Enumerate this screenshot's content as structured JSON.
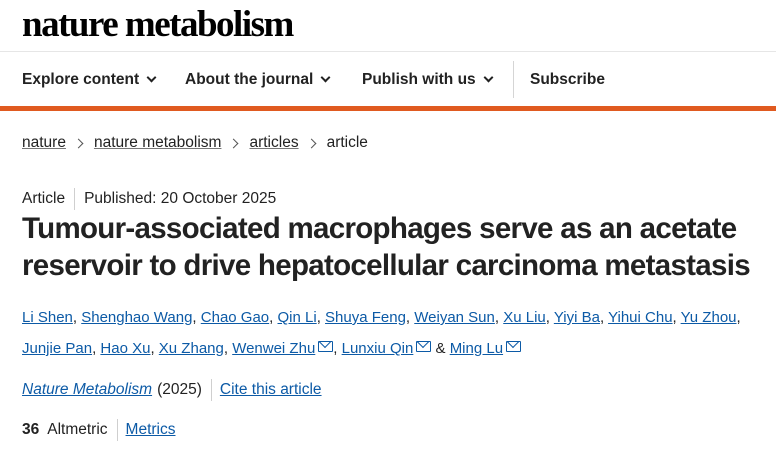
{
  "site": {
    "logo_text": "nature metabolism"
  },
  "nav": {
    "items": [
      {
        "label": "Explore content",
        "dropdown": true
      },
      {
        "label": "About the journal",
        "dropdown": true
      },
      {
        "label": "Publish with us",
        "dropdown": true
      }
    ],
    "subscribe_label": "Subscribe"
  },
  "colors": {
    "accent": "#e05a20",
    "link": "#0c5aa6"
  },
  "breadcrumb": [
    "nature",
    "nature metabolism",
    "articles",
    "article"
  ],
  "article": {
    "type": "Article",
    "published": "Published: 20 October 2025",
    "title": "Tumour-associated macrophages serve as an acetate reservoir to drive hepatocellular carcinoma metastasis",
    "authors": [
      {
        "name": "Li Shen",
        "email": false,
        "sep": ", "
      },
      {
        "name": "Shenghao Wang",
        "email": false,
        "sep": ", "
      },
      {
        "name": "Chao Gao",
        "email": false,
        "sep": ", "
      },
      {
        "name": "Qin Li",
        "email": false,
        "sep": ", "
      },
      {
        "name": "Shuya Feng",
        "email": false,
        "sep": ", "
      },
      {
        "name": "Weiyan Sun",
        "email": false,
        "sep": ", "
      },
      {
        "name": "Xu Liu",
        "email": false,
        "sep": ", "
      },
      {
        "name": "Yiyi Ba",
        "email": false,
        "sep": ", "
      },
      {
        "name": "Yihui Chu",
        "email": false,
        "sep": ", "
      },
      {
        "name": "Yu Zhou",
        "email": false,
        "sep": ", "
      },
      {
        "name": "Junjie Pan",
        "email": false,
        "sep": ", "
      },
      {
        "name": "Hao Xu",
        "email": false,
        "sep": ", "
      },
      {
        "name": "Xu Zhang",
        "email": false,
        "sep": ", "
      },
      {
        "name": "Wenwei Zhu",
        "email": true,
        "sep": ", "
      },
      {
        "name": "Lunxiu Qin",
        "email": true,
        "sep": " & "
      },
      {
        "name": "Ming Lu",
        "email": true,
        "sep": ""
      }
    ],
    "journal": "Nature Metabolism",
    "year": "(2025)",
    "cite_label": "Cite this article",
    "altmetric_score": "36",
    "altmetric_label": "Altmetric",
    "metrics_label": "Metrics"
  }
}
